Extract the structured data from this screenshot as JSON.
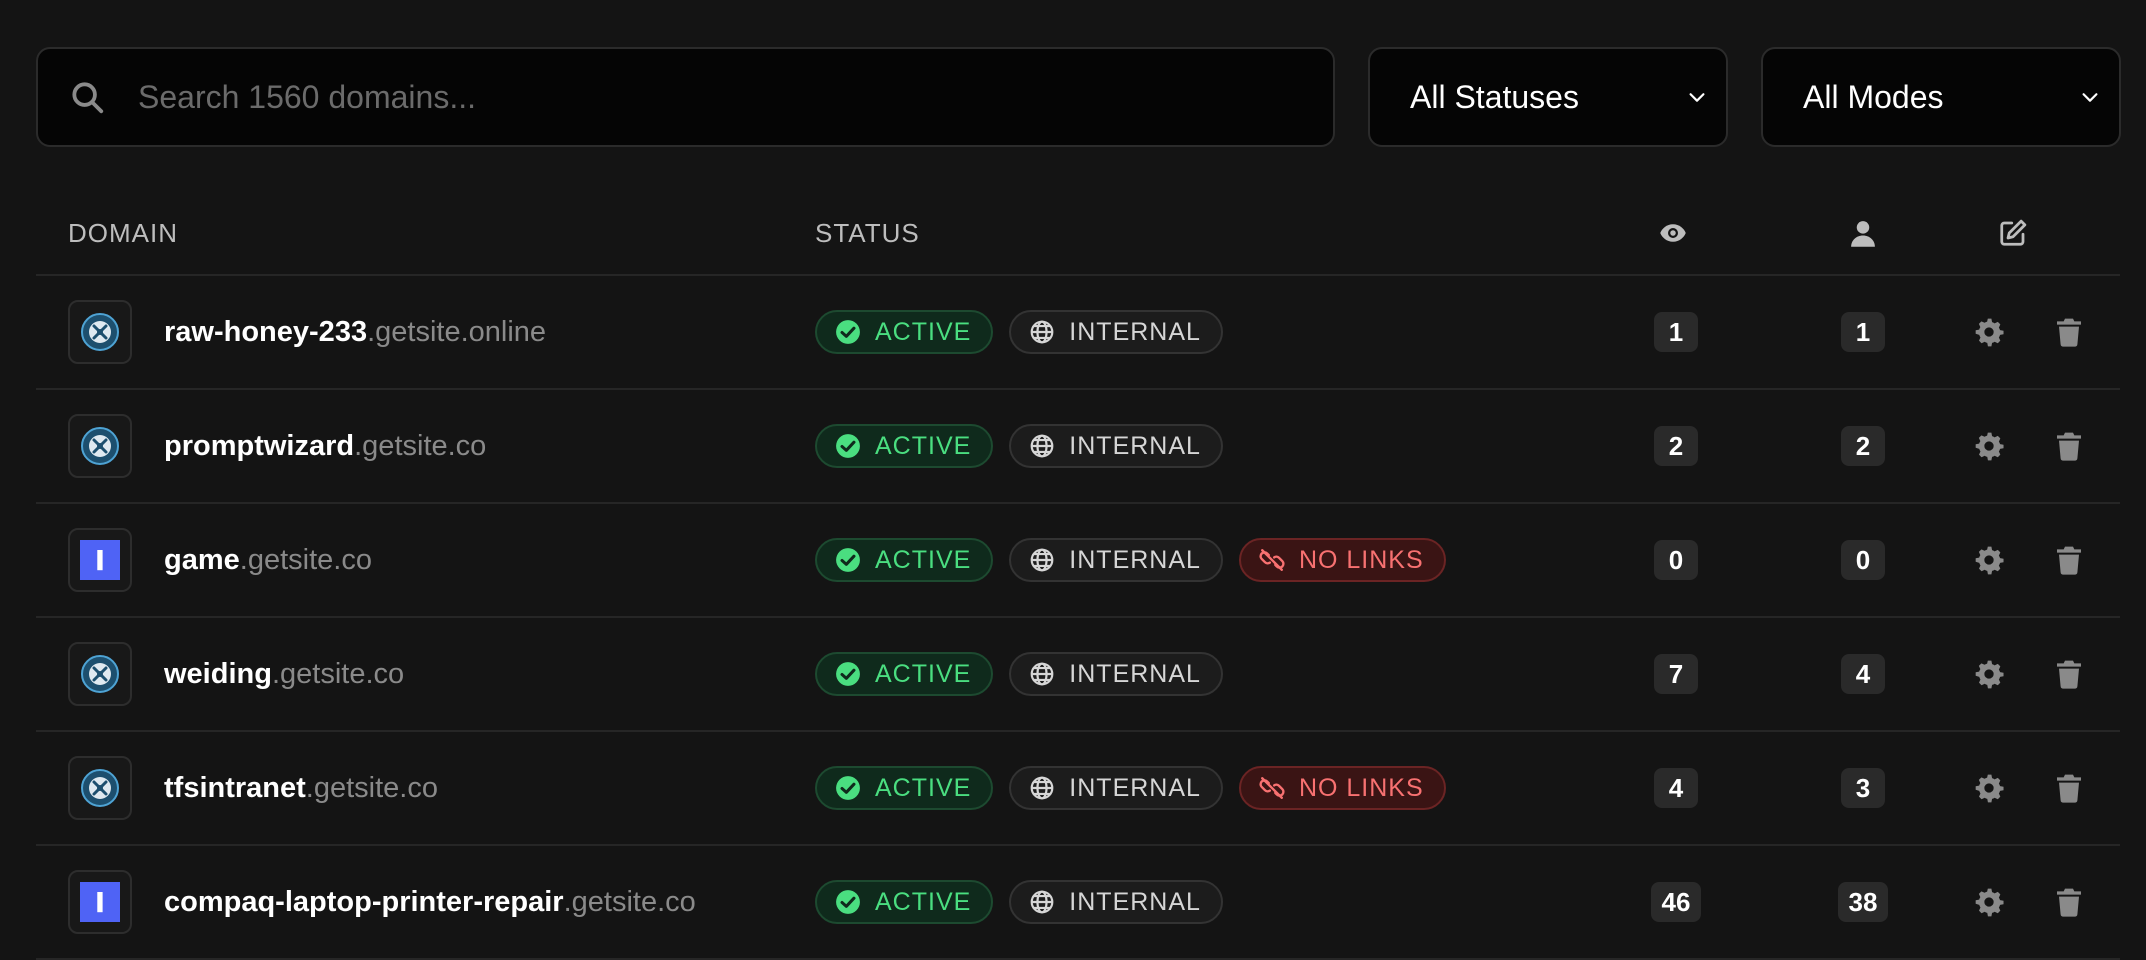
{
  "search": {
    "placeholder": "Search 1560 domains...",
    "icon": "search-icon"
  },
  "filters": {
    "status_value": "All Statuses",
    "mode_value": "All Modes"
  },
  "table": {
    "headers": {
      "domain": "DOMAIN",
      "status": "STATUS",
      "views_icon": "eye-icon",
      "users_icon": "user-icon",
      "edit_icon": "edit-icon"
    },
    "badge_labels": {
      "active": "ACTIVE",
      "internal": "INTERNAL",
      "no_links": "NO LINKS"
    },
    "rows": [
      {
        "subdomain": "raw-honey-233",
        "root": ".getsite.online",
        "favicon": "badge-logo-icon",
        "no_links": false,
        "views": "1",
        "users": "1"
      },
      {
        "subdomain": "promptwizard",
        "root": ".getsite.co",
        "favicon": "badge-logo-icon",
        "no_links": false,
        "views": "2",
        "users": "2"
      },
      {
        "subdomain": "game",
        "root": ".getsite.co",
        "favicon": "letter-i-icon",
        "no_links": true,
        "views": "0",
        "users": "0"
      },
      {
        "subdomain": "weiding",
        "root": ".getsite.co",
        "favicon": "badge-logo-icon",
        "no_links": false,
        "views": "7",
        "users": "4"
      },
      {
        "subdomain": "tfsintranet",
        "root": ".getsite.co",
        "favicon": "badge-logo-icon",
        "no_links": true,
        "views": "4",
        "users": "3"
      },
      {
        "subdomain": "compaq-laptop-printer-repair",
        "root": ".getsite.co",
        "favicon": "letter-i-icon",
        "no_links": false,
        "views": "46",
        "users": "38"
      }
    ]
  },
  "colors": {
    "background": "#141414",
    "active_green": "#4ade80",
    "no_links_red": "#f87171",
    "favicon_blue": "#4f63f5"
  }
}
